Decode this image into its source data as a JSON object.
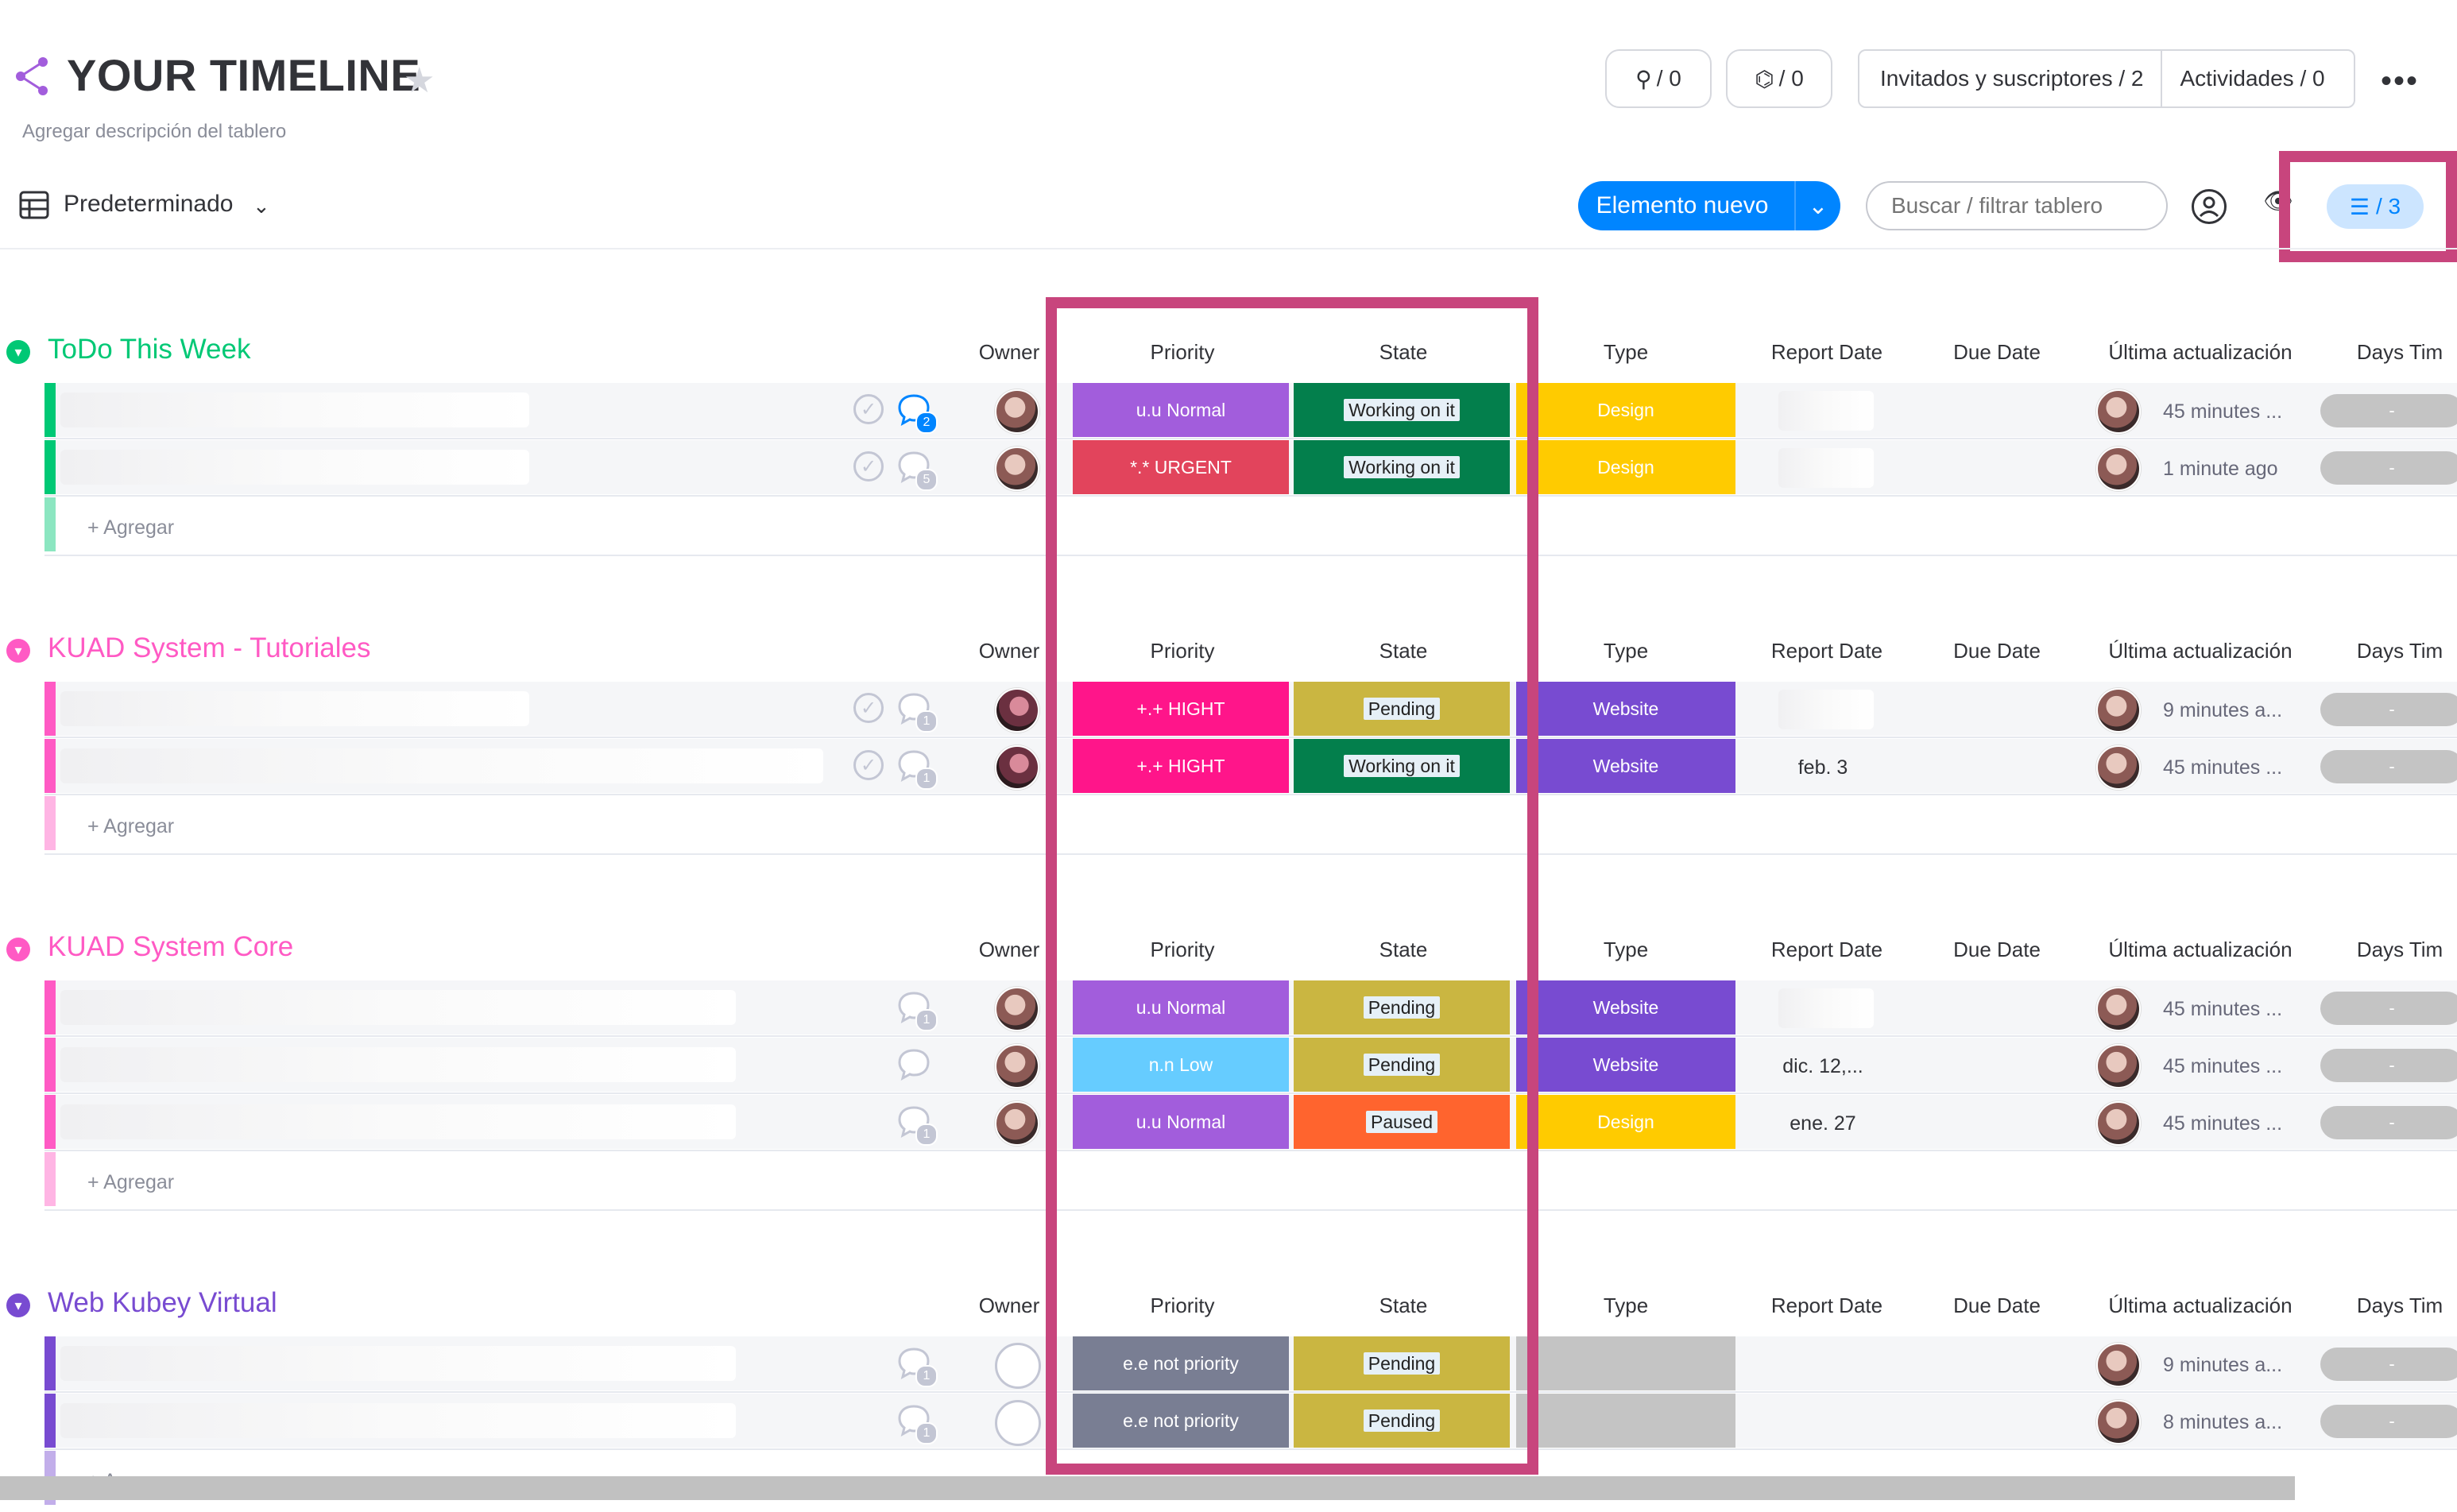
{
  "board": {
    "title": "YOUR TIMELINE",
    "description": "Agregar descripción del tablero",
    "view_label": "Predeterminado",
    "integrations_count": "/ 0",
    "automations_count": "/ 0",
    "invited_label": "Invitados y suscriptores / 2",
    "activities_label": "Actividades / 0",
    "new_item_label": "Elemento nuevo",
    "search_placeholder": "Buscar / filtrar tablero",
    "filter_count": "/ 3"
  },
  "columns": {
    "owner": "Owner",
    "priority": "Priority",
    "state": "State",
    "type": "Type",
    "report_date": "Report Date",
    "due_date": "Due Date",
    "last_update": "Última actualización",
    "days": "Days Tim"
  },
  "add_label": "+ Agregar",
  "colors": {
    "accent": "#0085ff",
    "highlight": "#c8457d",
    "group_todo": "#00c875",
    "group_kuad": "#ff5ac4",
    "group_web": "#784bd1"
  },
  "groups": [
    {
      "title": "ToDo This Week",
      "color": "#00c875",
      "rows": [
        {
          "priority": "u.u Normal",
          "priority_color": "#a25ddc",
          "state": "Working on it",
          "state_color": "#037f4c",
          "type": "Design",
          "type_color": "#ffcb00",
          "report_date": "",
          "updated": "45 minutes ...",
          "days": "-",
          "comments": "2"
        },
        {
          "priority": "*.* URGENT",
          "priority_color": "#e2445c",
          "state": "Working on it",
          "state_color": "#037f4c",
          "type": "Design",
          "type_color": "#ffcb00",
          "report_date": "",
          "updated": "1 minute ago",
          "days": "-",
          "comments": "5"
        }
      ]
    },
    {
      "title": "KUAD System - Tutoriales",
      "color": "#ff5ac4",
      "rows": [
        {
          "priority": "+.+ HIGHT",
          "priority_color": "#ff158a",
          "state": "Pending",
          "state_color": "#cab641",
          "type": "Website",
          "type_color": "#784bd1",
          "report_date": "",
          "updated": "9 minutes a...",
          "days": "-",
          "comments": "1"
        },
        {
          "priority": "+.+ HIGHT",
          "priority_color": "#ff158a",
          "state": "Working on it",
          "state_color": "#037f4c",
          "type": "Website",
          "type_color": "#784bd1",
          "report_date": "feb. 3",
          "updated": "45 minutes ...",
          "days": "-",
          "comments": "1"
        }
      ]
    },
    {
      "title": "KUAD System Core",
      "color": "#ff5ac4",
      "rows": [
        {
          "priority": "u.u Normal",
          "priority_color": "#a25ddc",
          "state": "Pending",
          "state_color": "#cab641",
          "type": "Website",
          "type_color": "#784bd1",
          "report_date": "",
          "updated": "45 minutes ...",
          "days": "-",
          "comments": "1"
        },
        {
          "priority": "n.n Low",
          "priority_color": "#66ccff",
          "state": "Pending",
          "state_color": "#cab641",
          "type": "Website",
          "type_color": "#784bd1",
          "report_date": "dic. 12,...",
          "updated": "45 minutes ...",
          "days": "-",
          "comments": ""
        },
        {
          "priority": "u.u Normal",
          "priority_color": "#a25ddc",
          "state": "Paused",
          "state_color": "#ff642e",
          "type": "Design",
          "type_color": "#ffcb00",
          "report_date": "ene. 27",
          "updated": "45 minutes ...",
          "days": "-",
          "comments": "1"
        }
      ]
    },
    {
      "title": "Web Kubey Virtual",
      "color": "#784bd1",
      "rows": [
        {
          "priority": "e.e not priority",
          "priority_color": "#797e93",
          "state": "Pending",
          "state_color": "#cab641",
          "type": "",
          "type_color": "#c4c4c4",
          "report_date": "",
          "updated": "9 minutes a...",
          "days": "-",
          "comments": "1"
        },
        {
          "priority": "e.e not priority",
          "priority_color": "#797e93",
          "state": "Pending",
          "state_color": "#cab641",
          "type": "",
          "type_color": "#c4c4c4",
          "report_date": "",
          "updated": "8 minutes a...",
          "days": "-",
          "comments": "1"
        }
      ]
    }
  ]
}
